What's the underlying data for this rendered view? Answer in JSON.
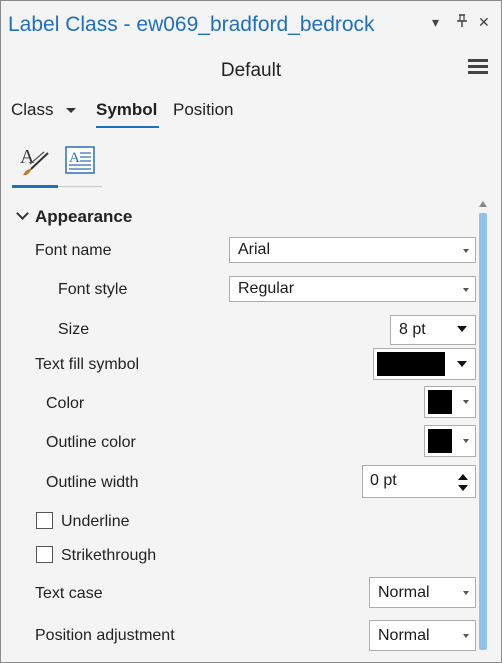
{
  "pane": {
    "title": "Label Class - ew069_bradford_bedrock",
    "controls": {
      "dropdown": "▾",
      "pin": "⊥",
      "close": "✕"
    }
  },
  "header": {
    "class_name": "Default",
    "menu_icon": "hamburger-icon"
  },
  "tabs": [
    {
      "label": "Class",
      "has_dropdown": true,
      "active": false
    },
    {
      "label": "Symbol",
      "active": true
    },
    {
      "label": "Position",
      "active": false
    }
  ],
  "subtabs": [
    {
      "name": "text-symbol-icon",
      "active": true
    },
    {
      "name": "text-formatting-icon",
      "active": false
    }
  ],
  "section": {
    "title": "Appearance",
    "expanded": true
  },
  "rows": {
    "font_name": {
      "label": "Font name",
      "value": "Arial"
    },
    "font_style": {
      "label": "Font style",
      "value": "Regular"
    },
    "size": {
      "label": "Size",
      "value": "8 pt"
    },
    "text_fill_symbol": {
      "label": "Text fill symbol",
      "color": "#000000"
    },
    "color": {
      "label": "Color",
      "color": "#000000"
    },
    "outline_color": {
      "label": "Outline color",
      "color": "#000000"
    },
    "outline_width": {
      "label": "Outline width",
      "value": "0 pt"
    },
    "underline": {
      "label": "Underline",
      "checked": false
    },
    "strikethrough": {
      "label": "Strikethrough",
      "checked": false
    },
    "text_case": {
      "label": "Text case",
      "value": "Normal"
    },
    "position_adjustment": {
      "label": "Position adjustment",
      "value": "Normal"
    }
  },
  "colors": {
    "accent": "#1f6fbf",
    "scrollbar": "#8ec3ec",
    "panel_bg": "#f4f4f4"
  }
}
